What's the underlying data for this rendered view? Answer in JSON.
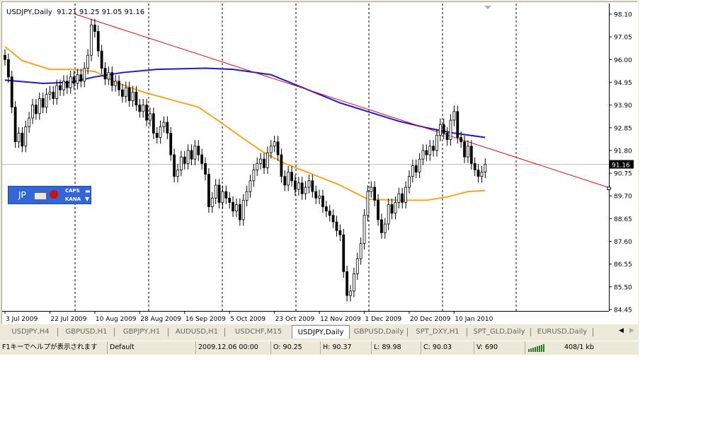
{
  "chart_header": {
    "symbol": "USDJPY,Daily",
    "ohlc": "91.21 91.25 91.05 91.16"
  },
  "chart_data": {
    "type": "candlestick",
    "symbol": "USDJPY",
    "timeframe": "Daily",
    "ylim": [
      84.45,
      98.1
    ],
    "y_ticks": [
      "98.10",
      "97.05",
      "96.00",
      "94.95",
      "93.90",
      "92.85",
      "91.80",
      "90.75",
      "89.70",
      "88.65",
      "87.60",
      "86.55",
      "85.50",
      "84.45"
    ],
    "x_ticks": [
      {
        "bar": 0,
        "label": "3 Jul 2009"
      },
      {
        "bar": 13,
        "label": "22 Jul 2009"
      },
      {
        "bar": 26,
        "label": "10 Aug 2009"
      },
      {
        "bar": 39,
        "label": "28 Aug 2009"
      },
      {
        "bar": 52,
        "label": "16 Sep 2009"
      },
      {
        "bar": 65,
        "label": "5 Oct 2009"
      },
      {
        "bar": 78,
        "label": "23 Oct 2009"
      },
      {
        "bar": 91,
        "label": "12 Nov 2009"
      },
      {
        "bar": 104,
        "label": "1 Dec 2009"
      },
      {
        "bar": 117,
        "label": "20 Dec 2009"
      },
      {
        "bar": 130,
        "label": "10 Jan 2010"
      }
    ],
    "current_price": "91.16",
    "close": [
      96.0,
      95.2,
      93.8,
      92.2,
      92.6,
      92.0,
      92.9,
      93.3,
      93.9,
      93.5,
      94.2,
      93.8,
      94.4,
      94.5,
      94.2,
      94.8,
      94.6,
      95.0,
      94.7,
      95.2,
      94.9,
      95.3,
      95.0,
      95.6,
      96.2,
      97.6,
      97.3,
      96.4,
      95.6,
      95.1,
      95.4,
      94.8,
      95.0,
      94.6,
      94.3,
      94.7,
      94.1,
      94.5,
      93.9,
      93.6,
      93.9,
      93.2,
      93.5,
      92.6,
      92.4,
      92.9,
      93.1,
      92.6,
      91.6,
      90.6,
      90.9,
      91.5,
      91.2,
      91.8,
      91.4,
      92.0,
      91.6,
      91.2,
      90.7,
      89.2,
      89.6,
      90.2,
      89.4,
      89.9,
      89.6,
      89.4,
      89.0,
      89.3,
      88.6,
      89.5,
      89.9,
      90.4,
      90.9,
      91.2,
      91.4,
      91.0,
      91.7,
      92.0,
      92.2,
      91.6,
      90.6,
      90.2,
      90.8,
      90.4,
      90.0,
      90.3,
      89.8,
      90.1,
      90.4,
      89.9,
      89.6,
      89.7,
      89.2,
      89.0,
      88.8,
      88.5,
      88.1,
      87.9,
      86.2,
      85.1,
      85.3,
      86.1,
      86.8,
      87.5,
      88.8,
      89.9,
      90.1,
      89.5,
      88.6,
      88.0,
      88.4,
      89.3,
      88.9,
      89.4,
      89.8,
      89.4,
      90.1,
      90.6,
      91.1,
      90.8,
      91.4,
      91.8,
      91.6,
      92.0,
      91.8,
      92.5,
      93.0,
      92.6,
      92.3,
      93.2,
      93.6,
      92.4,
      92.2,
      91.5,
      92.0,
      91.2,
      90.9,
      90.6,
      90.8,
      91.16
    ],
    "moving_averages": [
      {
        "color": "#f5a623",
        "points": [
          [
            0,
            96.6
          ],
          [
            5,
            95.95
          ],
          [
            13,
            95.55
          ],
          [
            19,
            95.55
          ],
          [
            26,
            95.45
          ],
          [
            32,
            94.95
          ],
          [
            40,
            94.5
          ],
          [
            48,
            94.15
          ],
          [
            56,
            93.8
          ],
          [
            62,
            93.15
          ],
          [
            69,
            92.35
          ],
          [
            75,
            91.7
          ],
          [
            81,
            91.2
          ],
          [
            89,
            90.7
          ],
          [
            97,
            90.2
          ],
          [
            105,
            89.55
          ],
          [
            114,
            89.5
          ],
          [
            122,
            89.5
          ],
          [
            128,
            89.65
          ],
          [
            134,
            89.9
          ],
          [
            139,
            89.95
          ]
        ]
      },
      {
        "color": "#1a1acc",
        "points": [
          [
            0,
            95.05
          ],
          [
            11,
            94.9
          ],
          [
            19,
            94.95
          ],
          [
            26,
            95.2
          ],
          [
            34,
            95.4
          ],
          [
            44,
            95.55
          ],
          [
            58,
            95.6
          ],
          [
            66,
            95.55
          ],
          [
            77,
            95.3
          ],
          [
            87,
            94.65
          ],
          [
            97,
            94.0
          ],
          [
            104,
            93.65
          ],
          [
            114,
            93.15
          ],
          [
            122,
            92.85
          ],
          [
            130,
            92.6
          ],
          [
            139,
            92.4
          ]
        ]
      }
    ],
    "trendline": {
      "color": "#cc1111",
      "from": [
        20.3,
        98.1
      ],
      "to": [
        175.5,
        90.05
      ]
    }
  },
  "ime": {
    "lang": "JP",
    "caps": "CAPS",
    "kana": "KANA"
  },
  "tabs": [
    {
      "label": "USDJPY,H4"
    },
    {
      "label": "GBPUSD,H1"
    },
    {
      "label": "GBPJPY,H1"
    },
    {
      "label": "AUDUSD,H1"
    },
    {
      "label": "USDCHF,M15"
    },
    {
      "label": "USDJPY,Daily",
      "active": true
    },
    {
      "label": "GBPUSD,Daily"
    },
    {
      "label": "SPT_DXY,H1"
    },
    {
      "label": "SPT_GLD,Daily"
    },
    {
      "label": "EURUSD,Daily"
    }
  ],
  "status": {
    "help": "F1キーでヘルプが表示されます",
    "profile": "Default",
    "datetime": "2009.12.06 00:00",
    "open": "O: 90.25",
    "high": "H: 90.37",
    "low": "L: 89.98",
    "close": "C: 90.03",
    "volume": "V: 690",
    "traffic": "408/1 kb"
  }
}
